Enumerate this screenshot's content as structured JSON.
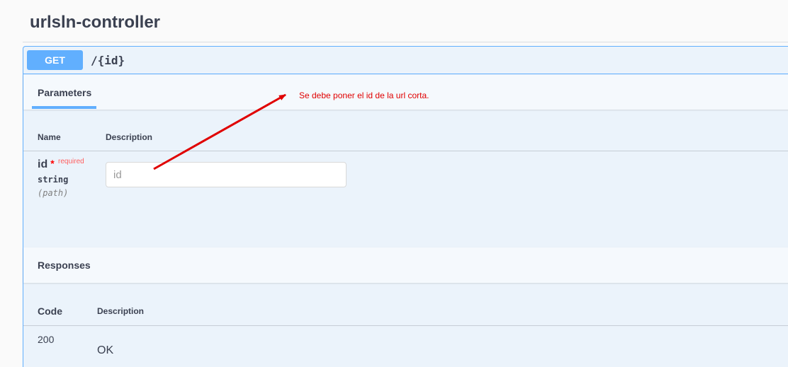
{
  "controller": {
    "title": "urlsln-controller"
  },
  "operation": {
    "method": "GET",
    "path": "/{id}"
  },
  "parameters": {
    "tab_label": "Parameters",
    "col_name": "Name",
    "col_description": "Description",
    "items": [
      {
        "name": "id",
        "required_star": "*",
        "required_label": "required",
        "type": "string",
        "in": "(path)",
        "placeholder": "id"
      }
    ]
  },
  "responses": {
    "title": "Responses",
    "col_code": "Code",
    "col_description": "Description",
    "items": [
      {
        "code": "200",
        "description": "OK"
      }
    ]
  },
  "annotation": {
    "text": "Se debe poner el id de la url corta.",
    "color": "#e00000"
  },
  "colors": {
    "get_accent": "#61affe",
    "block_bg": "#ebf3fb",
    "text": "#3b4151"
  }
}
